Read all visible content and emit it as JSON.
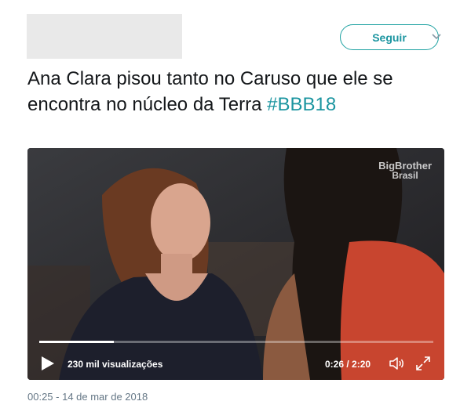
{
  "header": {
    "follow_label": "Seguir",
    "follow_color": "#1b95a0",
    "caret_icon": "chevron-down-icon"
  },
  "tweet": {
    "text": "Ana Clara pisou tanto no Caruso que ele se encontra no núcleo da Terra ",
    "hashtag": "#BBB18",
    "hashtag_color": "#1b95a0"
  },
  "video": {
    "watermark_line1": "BigBrother",
    "watermark_line2": "Brasil",
    "views": "230 mil visualizações",
    "time": "0:26 / 2:20",
    "progress": 0.19,
    "play_icon": "play-icon",
    "volume_icon": "volume-icon",
    "fullscreen_icon": "fullscreen-icon"
  },
  "footer": {
    "timestamp": "00:25 - 14 de mar de 2018"
  }
}
